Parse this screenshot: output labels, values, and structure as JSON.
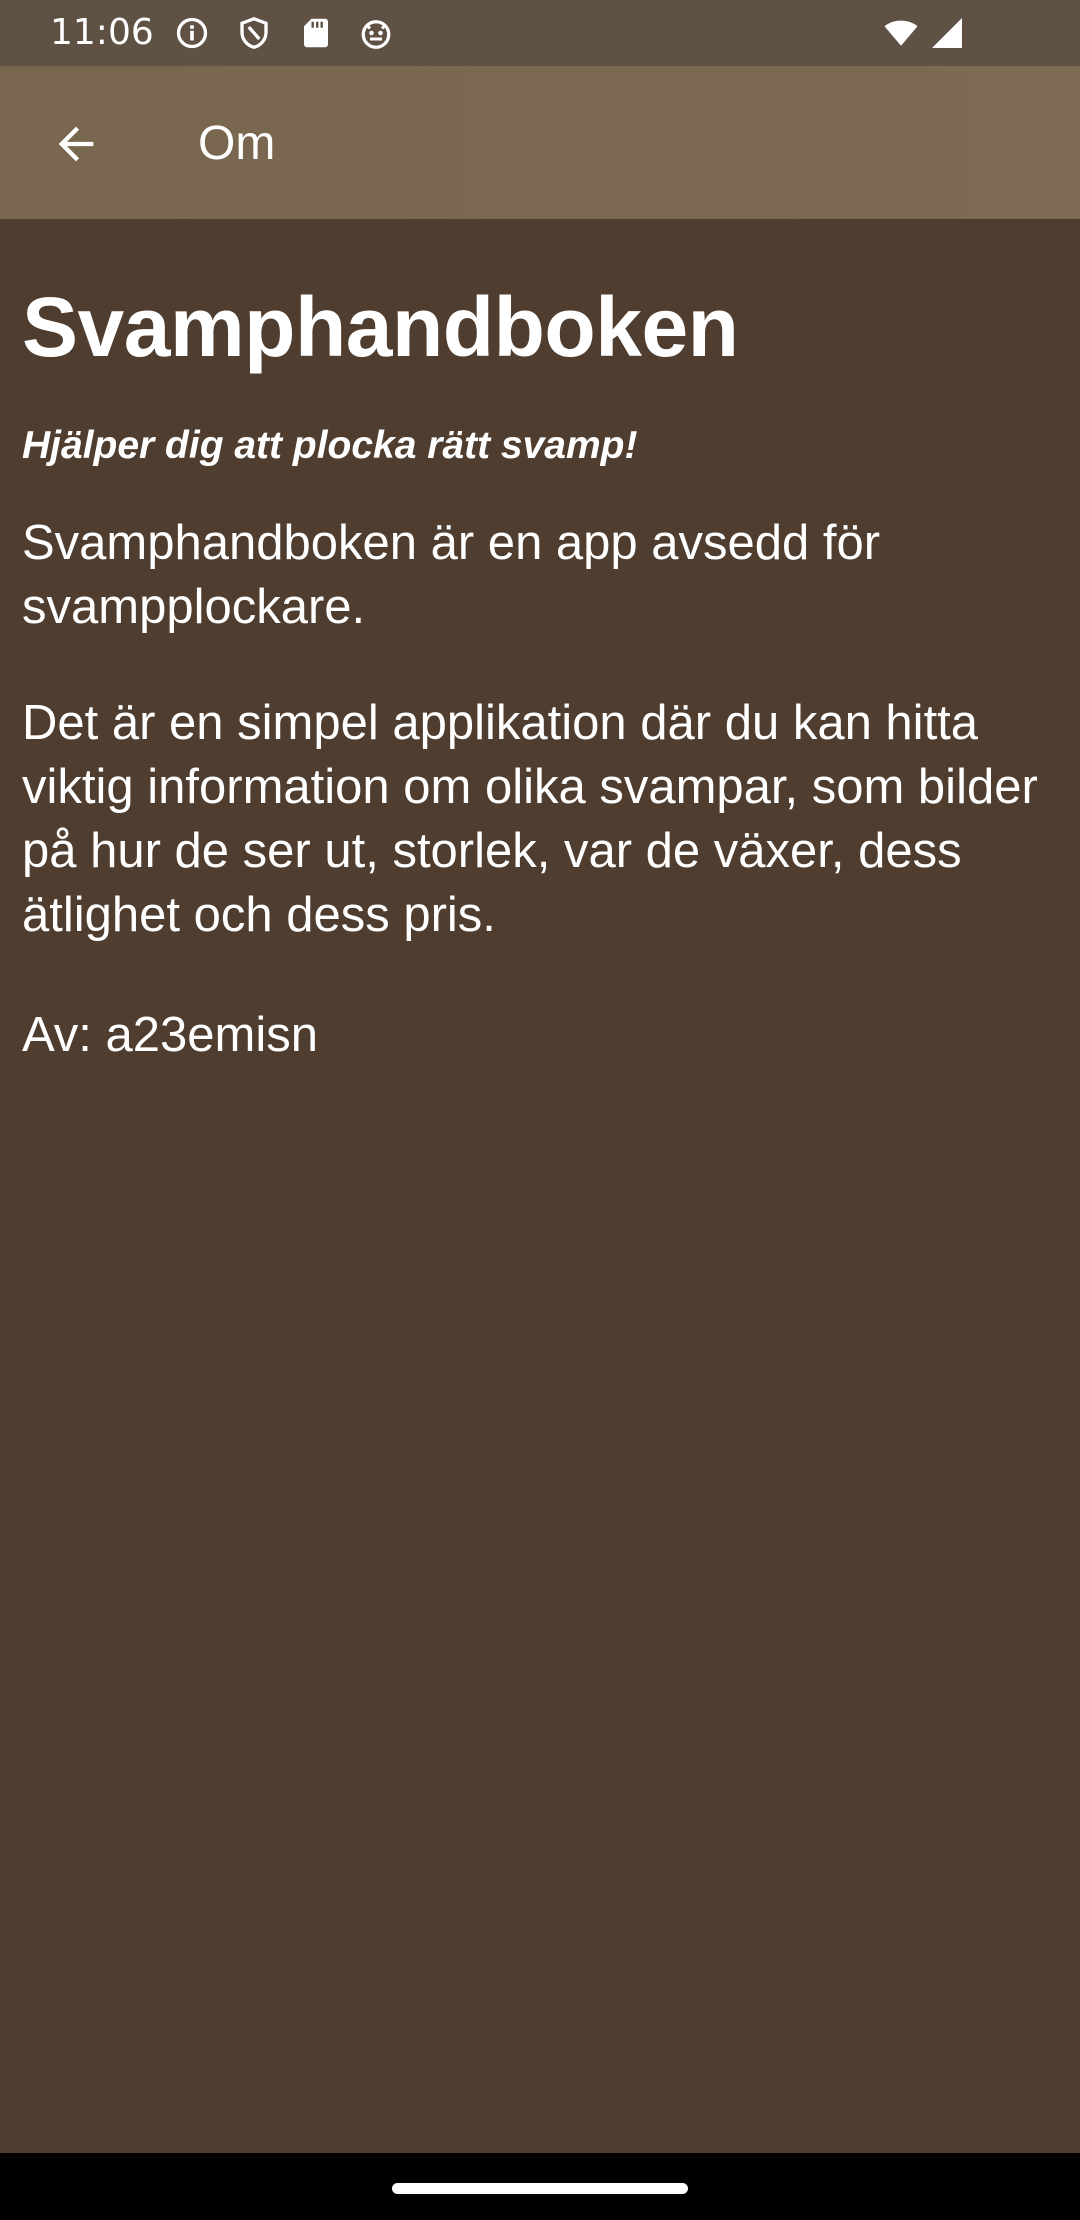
{
  "status_bar": {
    "time": "11:06",
    "icons": [
      "info-icon",
      "shield-icon",
      "sd-card-icon",
      "android-debug-icon",
      "wifi-icon",
      "signal-icon"
    ]
  },
  "app_bar": {
    "back_icon": "arrow-left-icon",
    "title": "Om"
  },
  "content": {
    "heading": "Svamphandboken",
    "tagline": "Hjälper dig att plocka rätt svamp!",
    "paragraph_1": "Svamphandboken är en app avsedd för svampplockare.",
    "paragraph_2": "Det är en simpel applikation där du kan hitta viktig information om olika svampar, som bilder på hur de ser ut, storlek, var de växer, dess ätlighet och dess pris.",
    "author": "Av: a23emisn"
  },
  "colors": {
    "status_bar": "#5f5144",
    "app_bar": "#7a6850",
    "background": "#4f3d2f",
    "text": "#ffffff"
  }
}
